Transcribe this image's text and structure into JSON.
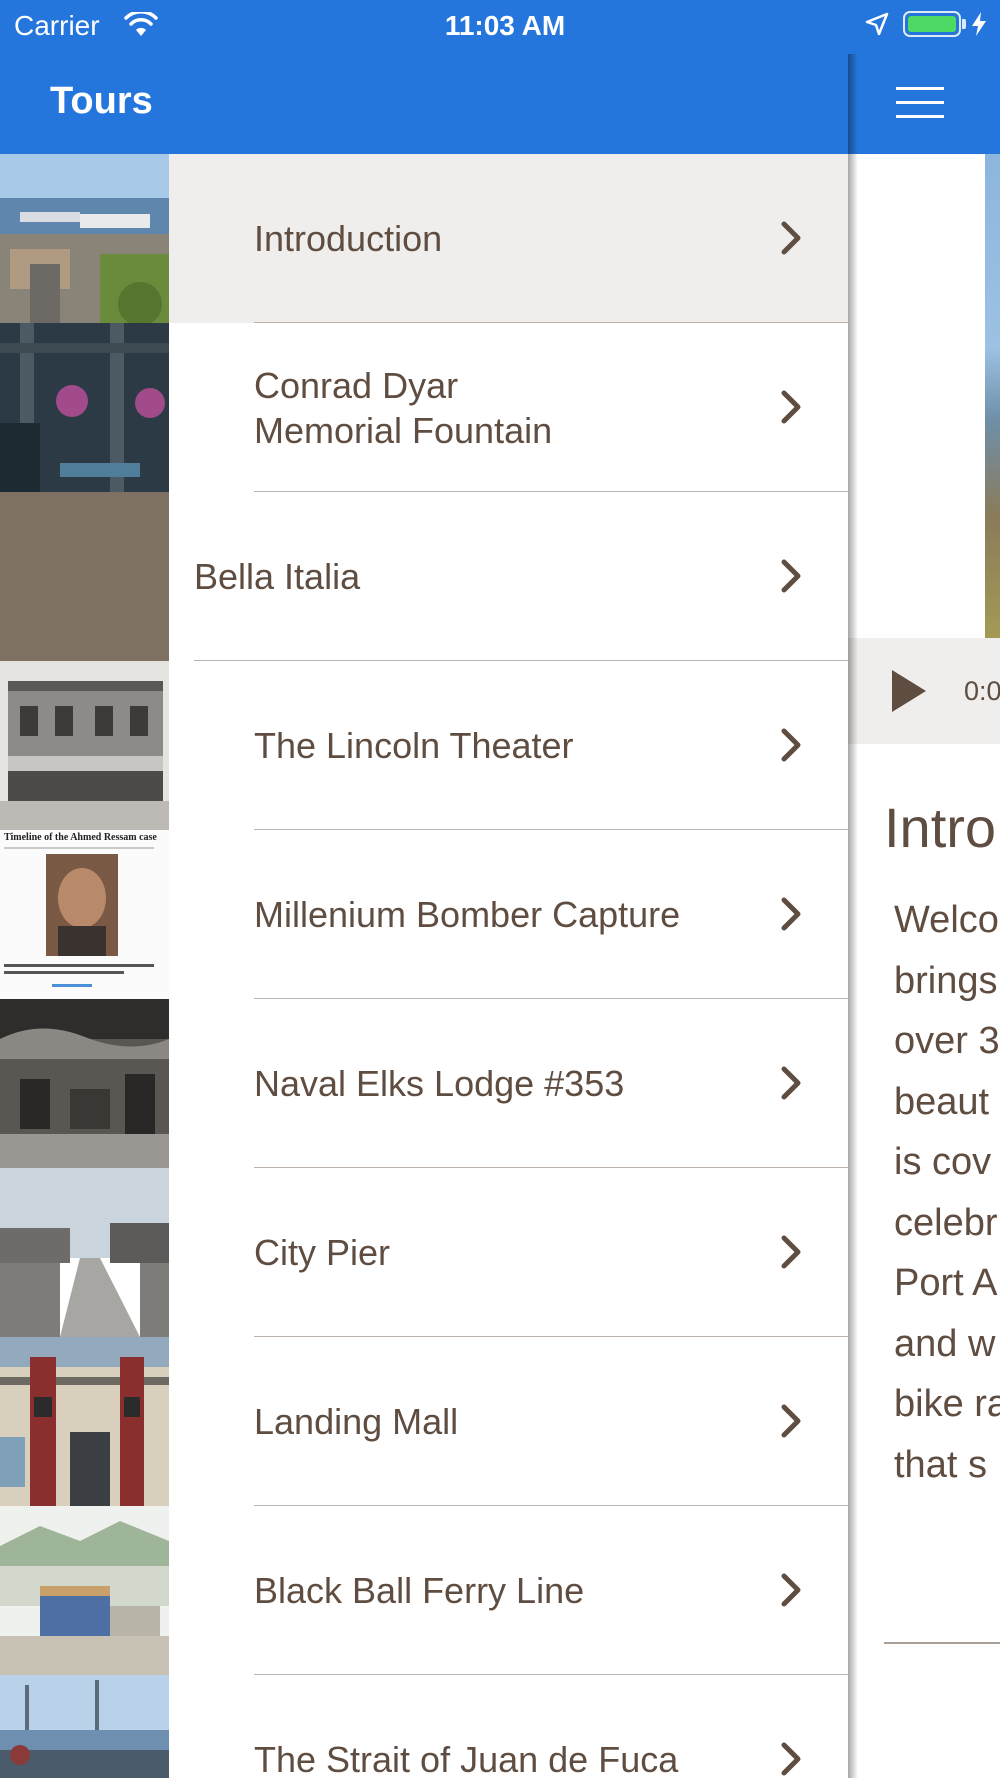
{
  "status_bar": {
    "carrier": "Carrier",
    "time": "11:03 AM",
    "battery_level": 1.0
  },
  "tours_panel": {
    "title": "Tours",
    "items": [
      {
        "label_line1": "Introduction",
        "label_line2": "",
        "selected": true,
        "indented": true,
        "thumb": "harbor-aerial-photo"
      },
      {
        "label_line1": "Conrad Dyar",
        "label_line2": "Memorial Fountain",
        "selected": false,
        "indented": true,
        "thumb": "fountain-hanging-baskets-photo"
      },
      {
        "label_line1": "Bella Italia",
        "label_line2": "",
        "selected": false,
        "indented": false,
        "thumb": "brown-placeholder"
      },
      {
        "label_line1": "The Lincoln Theater",
        "label_line2": "",
        "selected": false,
        "indented": true,
        "thumb": "lincoln-theater-bw-photo"
      },
      {
        "label_line1": "Millenium Bomber Capture",
        "label_line2": "",
        "selected": false,
        "indented": true,
        "thumb": "newspaper-timeline-clipping"
      },
      {
        "label_line1": "Naval Elks Lodge #353",
        "label_line2": "",
        "selected": false,
        "indented": true,
        "thumb": "elks-lodge-bw-photo"
      },
      {
        "label_line1": "City Pier",
        "label_line2": "",
        "selected": false,
        "indented": true,
        "thumb": "city-pier-bw-photo"
      },
      {
        "label_line1": "Landing Mall",
        "label_line2": "",
        "selected": false,
        "indented": true,
        "thumb": "landing-mall-totems-photo"
      },
      {
        "label_line1": "Black Ball Ferry Line",
        "label_line2": "",
        "selected": false,
        "indented": true,
        "thumb": "ferry-terminal-rendering"
      },
      {
        "label_line1": "The Strait of Juan de Fuca",
        "label_line2": "",
        "selected": false,
        "indented": true,
        "thumb": "strait-waterfront-photo"
      }
    ],
    "clipping_heading": "Timeline of the Ahmed Ressam case"
  },
  "detail_panel": {
    "player_time": "0:0",
    "title": "Intro",
    "body_lines": [
      "Welco",
      "brings",
      "over 3",
      "beaut",
      "is cov",
      "celebr",
      "Port A",
      "and w",
      "bike ra",
      "that s"
    ]
  },
  "colors": {
    "nav_blue": "#2476dc",
    "text_brown": "#5e4d40",
    "selected_row": "#efeeec",
    "placeholder_brown": "#7e7063"
  },
  "icons": {
    "row_disclosure": "chevron-right-icon",
    "menu": "hamburger-menu-icon",
    "audio": "play-icon"
  }
}
